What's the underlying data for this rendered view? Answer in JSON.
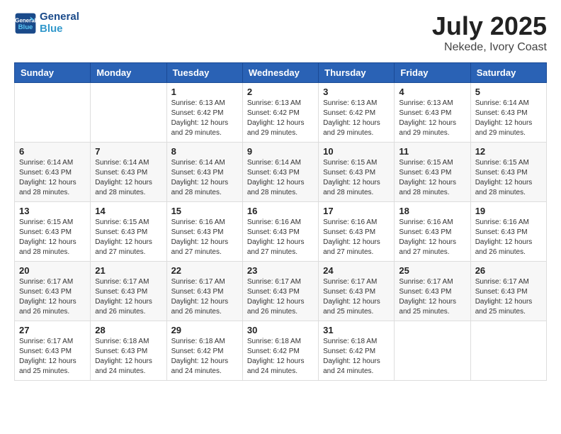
{
  "header": {
    "logo_line1": "General",
    "logo_line2": "Blue",
    "month_year": "July 2025",
    "location": "Nekede, Ivory Coast"
  },
  "weekdays": [
    "Sunday",
    "Monday",
    "Tuesday",
    "Wednesday",
    "Thursday",
    "Friday",
    "Saturday"
  ],
  "weeks": [
    [
      {
        "day": "",
        "detail": ""
      },
      {
        "day": "",
        "detail": ""
      },
      {
        "day": "1",
        "detail": "Sunrise: 6:13 AM\nSunset: 6:42 PM\nDaylight: 12 hours\nand 29 minutes."
      },
      {
        "day": "2",
        "detail": "Sunrise: 6:13 AM\nSunset: 6:42 PM\nDaylight: 12 hours\nand 29 minutes."
      },
      {
        "day": "3",
        "detail": "Sunrise: 6:13 AM\nSunset: 6:42 PM\nDaylight: 12 hours\nand 29 minutes."
      },
      {
        "day": "4",
        "detail": "Sunrise: 6:13 AM\nSunset: 6:43 PM\nDaylight: 12 hours\nand 29 minutes."
      },
      {
        "day": "5",
        "detail": "Sunrise: 6:14 AM\nSunset: 6:43 PM\nDaylight: 12 hours\nand 29 minutes."
      }
    ],
    [
      {
        "day": "6",
        "detail": "Sunrise: 6:14 AM\nSunset: 6:43 PM\nDaylight: 12 hours\nand 28 minutes."
      },
      {
        "day": "7",
        "detail": "Sunrise: 6:14 AM\nSunset: 6:43 PM\nDaylight: 12 hours\nand 28 minutes."
      },
      {
        "day": "8",
        "detail": "Sunrise: 6:14 AM\nSunset: 6:43 PM\nDaylight: 12 hours\nand 28 minutes."
      },
      {
        "day": "9",
        "detail": "Sunrise: 6:14 AM\nSunset: 6:43 PM\nDaylight: 12 hours\nand 28 minutes."
      },
      {
        "day": "10",
        "detail": "Sunrise: 6:15 AM\nSunset: 6:43 PM\nDaylight: 12 hours\nand 28 minutes."
      },
      {
        "day": "11",
        "detail": "Sunrise: 6:15 AM\nSunset: 6:43 PM\nDaylight: 12 hours\nand 28 minutes."
      },
      {
        "day": "12",
        "detail": "Sunrise: 6:15 AM\nSunset: 6:43 PM\nDaylight: 12 hours\nand 28 minutes."
      }
    ],
    [
      {
        "day": "13",
        "detail": "Sunrise: 6:15 AM\nSunset: 6:43 PM\nDaylight: 12 hours\nand 28 minutes."
      },
      {
        "day": "14",
        "detail": "Sunrise: 6:15 AM\nSunset: 6:43 PM\nDaylight: 12 hours\nand 27 minutes."
      },
      {
        "day": "15",
        "detail": "Sunrise: 6:16 AM\nSunset: 6:43 PM\nDaylight: 12 hours\nand 27 minutes."
      },
      {
        "day": "16",
        "detail": "Sunrise: 6:16 AM\nSunset: 6:43 PM\nDaylight: 12 hours\nand 27 minutes."
      },
      {
        "day": "17",
        "detail": "Sunrise: 6:16 AM\nSunset: 6:43 PM\nDaylight: 12 hours\nand 27 minutes."
      },
      {
        "day": "18",
        "detail": "Sunrise: 6:16 AM\nSunset: 6:43 PM\nDaylight: 12 hours\nand 27 minutes."
      },
      {
        "day": "19",
        "detail": "Sunrise: 6:16 AM\nSunset: 6:43 PM\nDaylight: 12 hours\nand 26 minutes."
      }
    ],
    [
      {
        "day": "20",
        "detail": "Sunrise: 6:17 AM\nSunset: 6:43 PM\nDaylight: 12 hours\nand 26 minutes."
      },
      {
        "day": "21",
        "detail": "Sunrise: 6:17 AM\nSunset: 6:43 PM\nDaylight: 12 hours\nand 26 minutes."
      },
      {
        "day": "22",
        "detail": "Sunrise: 6:17 AM\nSunset: 6:43 PM\nDaylight: 12 hours\nand 26 minutes."
      },
      {
        "day": "23",
        "detail": "Sunrise: 6:17 AM\nSunset: 6:43 PM\nDaylight: 12 hours\nand 26 minutes."
      },
      {
        "day": "24",
        "detail": "Sunrise: 6:17 AM\nSunset: 6:43 PM\nDaylight: 12 hours\nand 25 minutes."
      },
      {
        "day": "25",
        "detail": "Sunrise: 6:17 AM\nSunset: 6:43 PM\nDaylight: 12 hours\nand 25 minutes."
      },
      {
        "day": "26",
        "detail": "Sunrise: 6:17 AM\nSunset: 6:43 PM\nDaylight: 12 hours\nand 25 minutes."
      }
    ],
    [
      {
        "day": "27",
        "detail": "Sunrise: 6:17 AM\nSunset: 6:43 PM\nDaylight: 12 hours\nand 25 minutes."
      },
      {
        "day": "28",
        "detail": "Sunrise: 6:18 AM\nSunset: 6:43 PM\nDaylight: 12 hours\nand 24 minutes."
      },
      {
        "day": "29",
        "detail": "Sunrise: 6:18 AM\nSunset: 6:42 PM\nDaylight: 12 hours\nand 24 minutes."
      },
      {
        "day": "30",
        "detail": "Sunrise: 6:18 AM\nSunset: 6:42 PM\nDaylight: 12 hours\nand 24 minutes."
      },
      {
        "day": "31",
        "detail": "Sunrise: 6:18 AM\nSunset: 6:42 PM\nDaylight: 12 hours\nand 24 minutes."
      },
      {
        "day": "",
        "detail": ""
      },
      {
        "day": "",
        "detail": ""
      }
    ]
  ]
}
